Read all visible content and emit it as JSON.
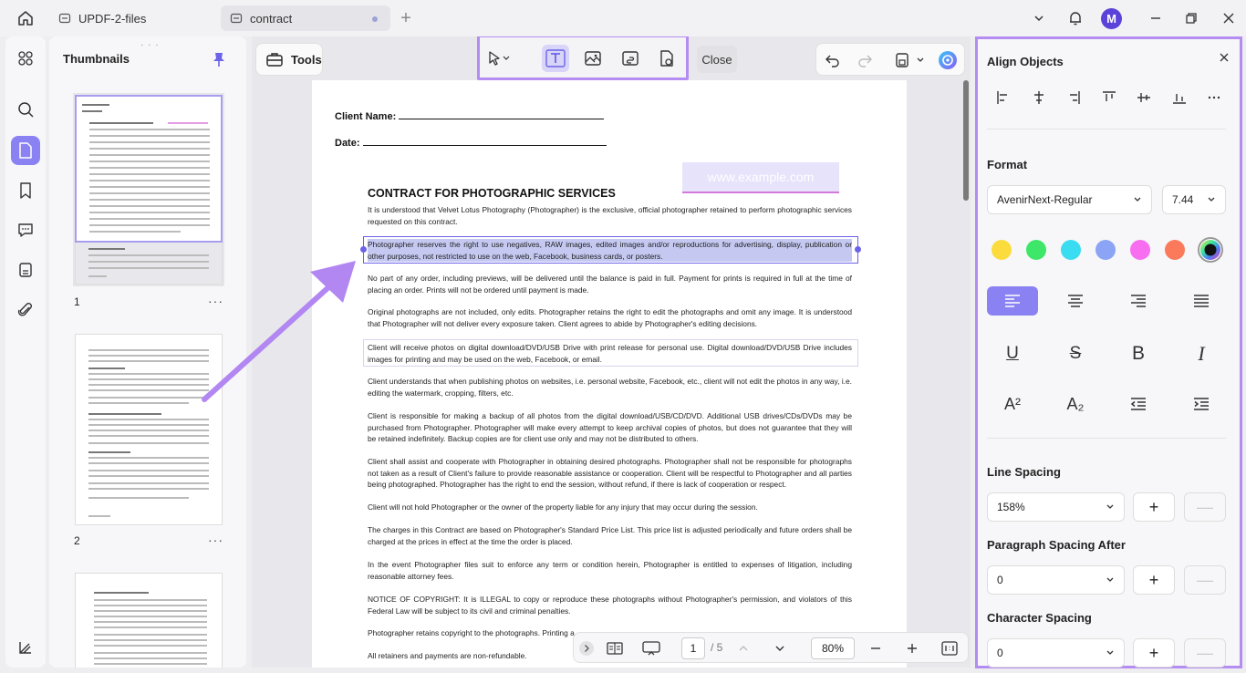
{
  "tabs": [
    {
      "label": "UPDF-2-files"
    },
    {
      "label": "contract"
    }
  ],
  "user": {
    "initial": "M"
  },
  "thumbnails": {
    "title": "Thumbnails",
    "pages": [
      {
        "num": "1"
      },
      {
        "num": "2"
      },
      {
        "num": ""
      }
    ],
    "more": "···"
  },
  "toolbar": {
    "tools_label": "Tools",
    "close_label": "Close"
  },
  "document": {
    "client_name_label": "Client Name:",
    "date_label": "Date:",
    "watermark": "www.example.com",
    "heading": "CONTRACT FOR PHOTOGRAPHIC SERVICES",
    "paragraphs": [
      "It is understood that Velvet Lotus Photography (Photographer) is the exclusive, official photographer retained to perform photographic services requested on this contract.",
      "Photographer reserves the right to use negatives, RAW images, edited images and/or reproductions for advertising, display, publication or other purposes, not restricted to use on the web, Facebook, business cards, or posters.",
      "No part of any order, including previews, will be delivered until the balance is paid in full. Payment for prints is required in full at the time of placing an order. Prints will not be ordered until payment is made.",
      "Original photographs are not included, only edits. Photographer retains the right to edit the photographs and omit any image. It is understood that Photographer will not deliver every exposure taken. Client agrees to abide by Photographer's editing decisions.",
      "Client will receive photos on digital download/DVD/USB Drive with print release for personal use. Digital download/DVD/USB Drive includes images for printing and may be used on the web, Facebook, or email.",
      "Client understands that when publishing photos on websites, i.e. personal website, Facebook, etc., client will not edit the photos in any way, i.e. editing the watermark, cropping, filters, etc.",
      "Client is responsible for making a backup of all photos from the digital download/USB/CD/DVD. Additional USB drives/CDs/DVDs may be purchased from Photographer. Photographer will make every attempt to keep archival copies of photos, but does not guarantee that they will be retained indefinitely. Backup copies are for client use only and may not be distributed to others.",
      "Client shall assist and cooperate with Photographer in obtaining desired photographs. Photographer shall not be responsible for photographs not taken as a result of Client's failure to provide reasonable assistance or cooperation. Client will be respectful to Photographer and all parties being photographed. Photographer has the right to end the session, without refund, if there is lack of cooperation or respect.",
      "Client will not hold Photographer or the owner of the property liable for any injury that may occur during the session.",
      "The charges in this Contract are based on Photographer's Standard Price List. This price list is adjusted periodically and future orders shall be charged at the prices in effect at the time the order is placed.",
      "In the event Photographer files suit to enforce any term or condition herein, Photographer is entitled to expenses of litigation, including reasonable attorney fees.",
      "NOTICE OF COPYRIGHT: It is ILLEGAL to copy or reproduce these photographs without Photographer's permission, and violators of this Federal Law will be subject to its civil and criminal penalties.",
      "Photographer retains copyright to the photographs. Printing a",
      "All retainers and payments are non-refundable."
    ]
  },
  "pager": {
    "current_page": "1",
    "total": "/ 5",
    "zoom": "80%"
  },
  "panel": {
    "align_title": "Align Objects",
    "format_title": "Format",
    "font_name": "AvenirNext-Regular",
    "font_size": "7.44",
    "colors": [
      "#fbdc3c",
      "#3ee66a",
      "#39dcf0",
      "#8ba4f5",
      "#f76ef0",
      "#fb7a5c"
    ],
    "line_spacing_title": "Line Spacing",
    "line_spacing_value": "158%",
    "para_spacing_title": "Paragraph Spacing After",
    "para_spacing_value": "0",
    "char_spacing_title": "Character Spacing",
    "char_spacing_value": "0",
    "plus": "+",
    "minus": "—",
    "superscript": "A²",
    "subscript": "A₂",
    "bold": "B",
    "italic": "I",
    "underline": "U",
    "strike": "S"
  }
}
